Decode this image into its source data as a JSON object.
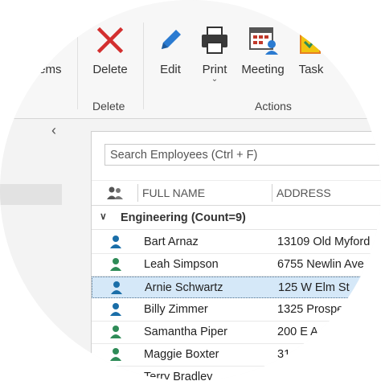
{
  "ribbon": {
    "items_partial_label": "tems",
    "delete_label": "Delete",
    "edit_label": "Edit",
    "print_label": "Print",
    "meeting_label": "Meeting",
    "task_label": "Task",
    "group_delete": "Delete",
    "group_actions": "Actions"
  },
  "search": {
    "placeholder": "Search Employees (Ctrl + F)"
  },
  "columns": {
    "full_name": "FULL NAME",
    "address": "ADDRESS"
  },
  "group": {
    "label": "Engineering (Count=9)"
  },
  "rows": [
    {
      "name": "Bart Arnaz",
      "address": "13109 Old Myford",
      "icon_color": "#1a6ea8"
    },
    {
      "name": "Leah Simpson",
      "address": "6755 Newlin Ave",
      "icon_color": "#2e8b57"
    },
    {
      "name": "Arnie Schwartz",
      "address": "125 W Elm St",
      "icon_color": "#1a6ea8"
    },
    {
      "name": "Billy Zimmer",
      "address": "1325 Prospe",
      "icon_color": "#1a6ea8"
    },
    {
      "name": "Samantha Piper",
      "address": "200 E A",
      "icon_color": "#2e8b57"
    },
    {
      "name": "Maggie Boxter",
      "address": "31",
      "icon_color": "#2e8b57"
    },
    {
      "name": "Terry Bradley",
      "address": "",
      "icon_color": "#1a6ea8"
    }
  ],
  "colors": {
    "delete_red": "#d32f2f",
    "edit_blue": "#2b7bd1",
    "selection": "#d5e8f8"
  }
}
